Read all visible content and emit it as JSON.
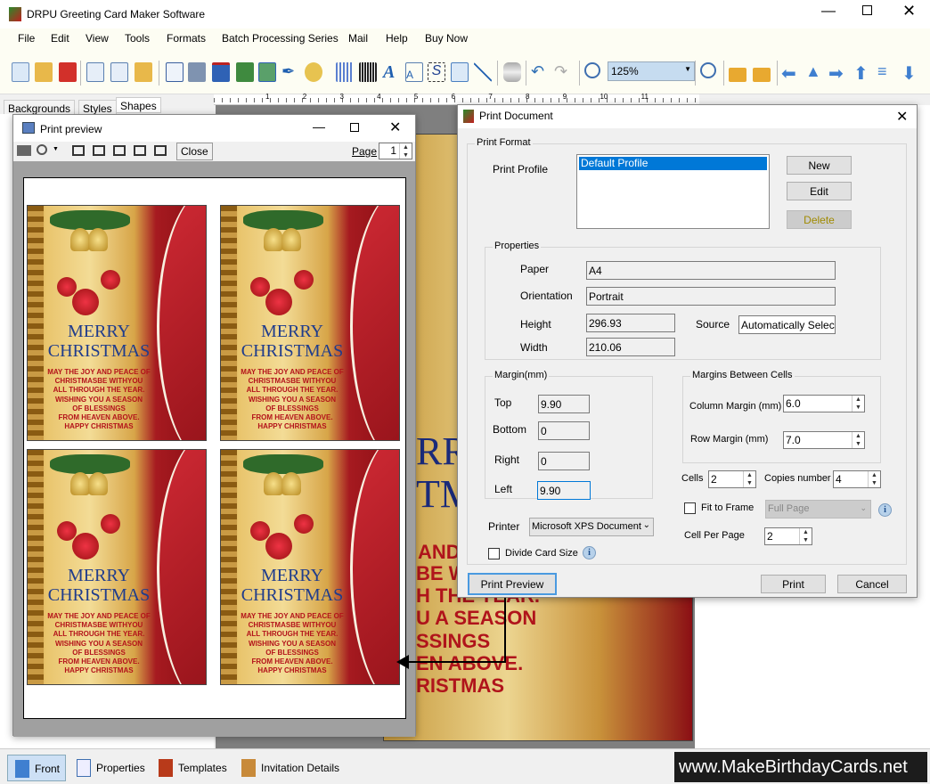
{
  "app": {
    "title": "DRPU Greeting Card Maker Software"
  },
  "menu": [
    "File",
    "Edit",
    "View",
    "Tools",
    "Formats",
    "Batch Processing Series",
    "Mail",
    "Help",
    "Buy Now"
  ],
  "toolbar": {
    "zoom_value": "125%"
  },
  "left_tabs": [
    "Backgrounds",
    "Styles",
    "Shapes"
  ],
  "ruler_labels": [
    "1",
    "2",
    "3",
    "4",
    "5",
    "6",
    "7",
    "8",
    "9",
    "10",
    "11"
  ],
  "background_card": {
    "lines": [
      "RR",
      "TM",
      "AND I",
      "BE W",
      "H THE YEAR.",
      "U A SEASON",
      "SSINGS",
      "EN ABOVE.",
      "RISTMAS"
    ]
  },
  "print_preview": {
    "title": "Print preview",
    "close_label": "Close",
    "page_label": "Page",
    "page_value": "1",
    "card": {
      "title1": "MERRY",
      "title2": "CHRISTMAS",
      "message": [
        "MAY THE JOY AND PEACE OF",
        "CHRISTMASBE WITHYOU",
        "ALL THROUGH THE YEAR.",
        "WISHING YOU A SEASON",
        "OF BLESSINGS",
        "FROM HEAVEN ABOVE.",
        "HAPPY CHRISTMAS"
      ]
    }
  },
  "print_document": {
    "title": "Print Document",
    "print_format": "Print Format",
    "print_profile_label": "Print Profile",
    "profiles": [
      "Default Profile"
    ],
    "new": "New",
    "edit": "Edit",
    "delete": "Delete",
    "properties": {
      "label": "Properties",
      "paper_label": "Paper",
      "paper": "A4",
      "orientation_label": "Orientation",
      "orientation": "Portrait",
      "height_label": "Height",
      "height": "296.93",
      "width_label": "Width",
      "width": "210.06",
      "source_label": "Source",
      "source": "Automatically Select"
    },
    "margin": {
      "label": "Margin(mm)",
      "top_label": "Top",
      "top": "9.90",
      "bottom_label": "Bottom",
      "bottom": "0",
      "right_label": "Right",
      "right": "0",
      "left_label": "Left",
      "left": "9.90"
    },
    "cells_margin": {
      "label": "Margins Between Cells",
      "column_label": "Column Margin (mm)",
      "column": "6.0",
      "row_label": "Row Margin (mm)",
      "row": "7.0"
    },
    "cells_label": "Cells",
    "cells": "2",
    "copies_label": "Copies number",
    "copies": "4",
    "fit_to_frame_label": "Fit to Frame",
    "fit_to_frame_checked": false,
    "fit_option": "Full Page",
    "cell_per_page_label": "Cell Per Page",
    "cell_per_page": "2",
    "printer_label": "Printer",
    "printer": "Microsoft XPS Document",
    "divide_card_label": "Divide Card Size",
    "divide_card_checked": false,
    "print_preview_btn": "Print Preview",
    "print_btn": "Print",
    "cancel_btn": "Cancel"
  },
  "bottom_tabs": [
    "Front",
    "Properties",
    "Templates",
    "Invitation Details"
  ],
  "watermark": "www.MakeBirthdayCards.net"
}
